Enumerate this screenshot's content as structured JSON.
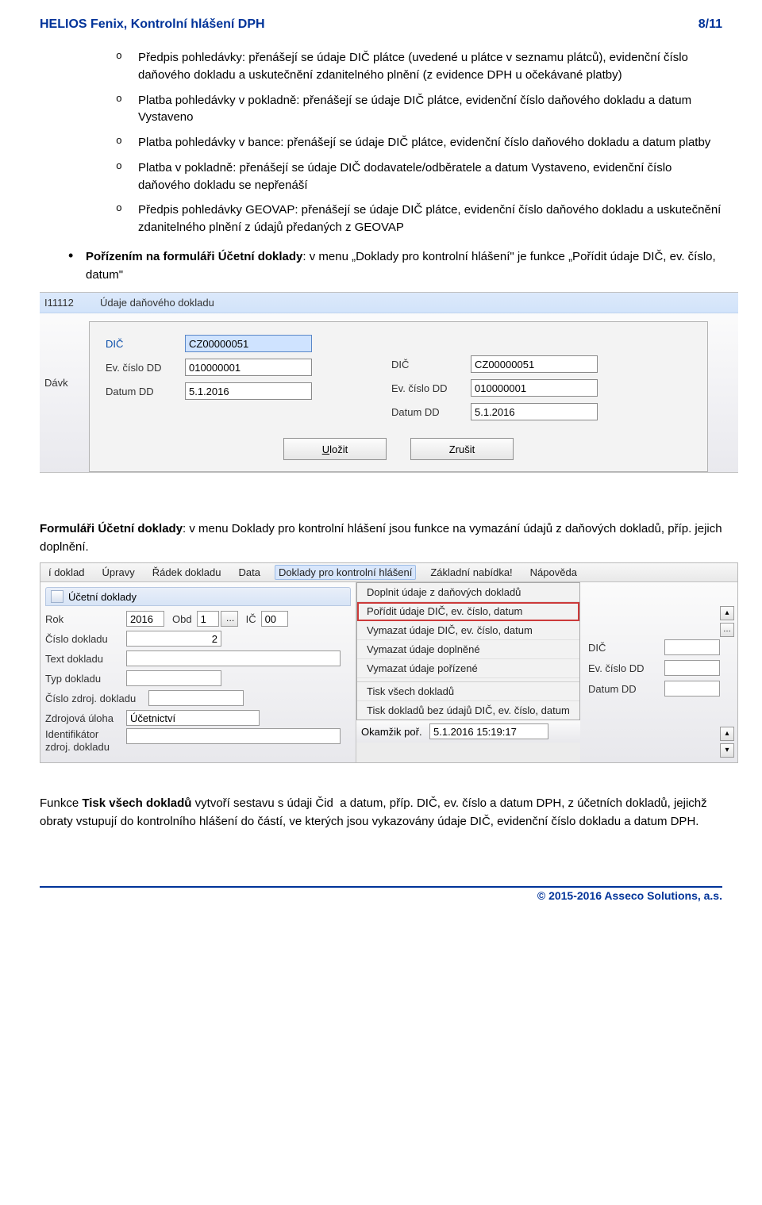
{
  "header": {
    "title": "HELIOS Fenix, Kontrolní hlášení DPH",
    "page": "8/11"
  },
  "sub_items": [
    "Předpis pohledávky: přenášejí se údaje DIČ plátce (uvedené u plátce v seznamu plátců), evidenční číslo daňového dokladu a uskutečnění zdanitelného plnění (z evidence DPH u očekávané platby)",
    "Platba pohledávky v pokladně: přenášejí se údaje DIČ plátce, evidenční číslo daňového dokladu a datum Vystaveno",
    "Platba pohledávky v bance: přenášejí se údaje DIČ plátce, evidenční číslo daňového dokladu a datum platby",
    "Platba v pokladně: přenášejí se údaje DIČ dodavatele/odběratele a datum Vystaveno, evidenční číslo daňového dokladu se nepřenáší",
    "Předpis pohledávky GEOVAP: přenášejí se údaje DIČ plátce, evidenční číslo daňového dokladu a uskutečnění zdanitelného plnění z údajů předaných z GEOVAP"
  ],
  "top_bullet": {
    "bold": "Pořízením na formuláři Účetní doklady",
    "rest": ": v menu „Doklady pro kontrolní hlášení\" je funkce „Pořídit údaje DIČ, ev. číslo, datum\""
  },
  "shot1": {
    "blue_num": "I11112",
    "blue_title": "Údaje daňového dokladu",
    "left_label": "Dávk",
    "dic_lbl": "DIČ",
    "ev_lbl": "Ev. číslo DD",
    "date_lbl": "Datum DD",
    "dic_val": "CZ00000051",
    "ev_val": "010000001",
    "date_val": "5.1.2016",
    "dic2_val": "CZ00000051",
    "ev2_val": "010000001",
    "date2_val": "5.1.2016",
    "btn_save": "Uložit",
    "btn_cancel": "Zrušit"
  },
  "para1": {
    "bold": "Formuláři Účetní doklady",
    "rest": ": v menu Doklady pro kontrolní hlášení jsou funkce na vymazání údajů z daňových dokladů, příp. jejich doplnění."
  },
  "shot2": {
    "menubar": [
      "í doklad",
      "Úpravy",
      "Řádek dokladu",
      "Data",
      "Doklady pro kontrolní hlášení",
      "Základní nabídka!",
      "Nápověda"
    ],
    "menubar_active_index": 4,
    "tab_title": "Účetní doklady",
    "left": {
      "rok_lbl": "Rok",
      "rok_val": "2016",
      "obd_lbl": "Obd",
      "obd_val": "1",
      "ic_lbl": "IČ",
      "ic_val": "00",
      "cislo_lbl": "Číslo dokladu",
      "cislo_val": "2",
      "text_lbl": "Text dokladu",
      "typ_lbl": "Typ dokladu",
      "cz_lbl": "Číslo zdroj. dokladu",
      "zu_lbl": "Zdrojová úloha",
      "zu_val": "Účetnictví",
      "id_lbl": "Identifikátor zdroj. dokladu",
      "okam_lbl": "Okamžik poř.",
      "okam_val": "5.1.2016 15:19:17"
    },
    "dd": [
      "Doplnit údaje z daňových dokladů",
      "Pořídit údaje DIČ, ev. číslo, datum",
      "Vymazat údaje DIČ, ev. číslo, datum",
      "Vymazat údaje doplněné",
      "Vymazat údaje pořízené",
      "Tisk všech dokladů",
      "Tisk dokladů bez údajů DIČ, ev. číslo, datum"
    ],
    "dd_hl_index": 1,
    "right": {
      "dic_lbl": "DIČ",
      "ev_lbl": "Ev. číslo DD",
      "date_lbl": "Datum DD"
    }
  },
  "para2": "Funkce Tisk všech dokladů vytvoří sestavu s údaji Čid  a datum, příp. DIČ, ev. číslo a datum DPH, z účetních dokladů, jejichž obraty vstupují do kontrolního hlášení do částí, ve kterých jsou vykazovány údaje DIČ, evidenční číslo dokladu a datum DPH.",
  "para2_bold": "Tisk všech dokladů",
  "footer": "© 2015-2016 Asseco Solutions, a.s."
}
